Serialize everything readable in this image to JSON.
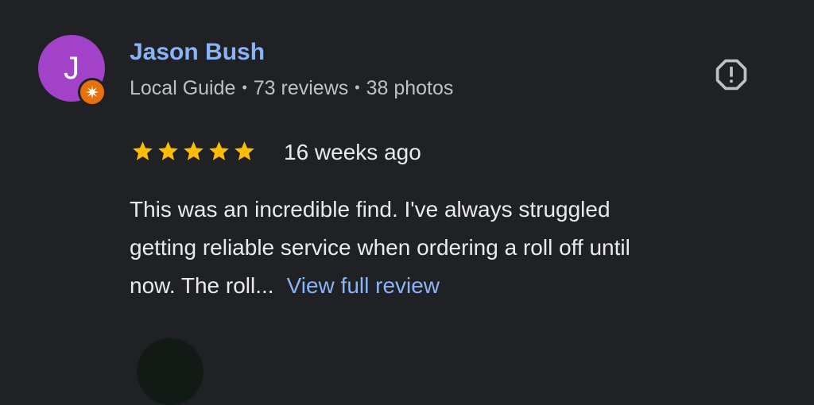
{
  "theme": {
    "background": "#202124",
    "link_color": "#8ab4f8",
    "avatar_color": "#a142c8",
    "badge_color": "#e8710a",
    "star_color": "#fbbc04"
  },
  "review": {
    "author": {
      "initial": "J",
      "name": "Jason Bush",
      "badge_icon": "local-guide-star-icon",
      "meta": {
        "role": "Local Guide",
        "reviews": "73 reviews",
        "photos": "38 photos",
        "separator": "•"
      }
    },
    "report_icon": "report-icon",
    "rating": 5,
    "rating_max": 5,
    "date": "16 weeks ago",
    "text_lines": [
      "This was an incredible find. I've always struggled",
      "getting reliable service when ordering a roll off until",
      "now. The roll..."
    ],
    "view_full_label": "View full review"
  }
}
